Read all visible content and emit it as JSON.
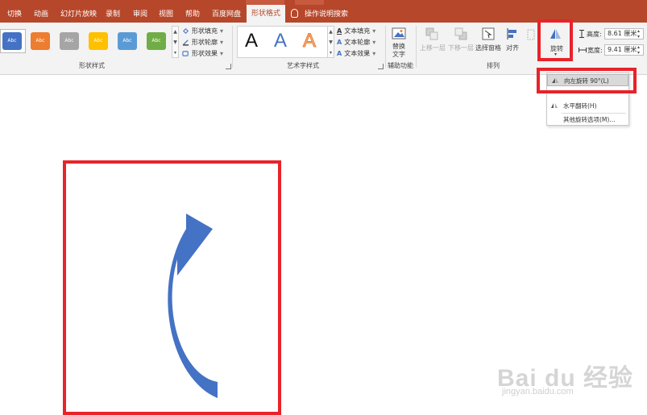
{
  "tabs": [
    {
      "label": "切换"
    },
    {
      "label": "动画"
    },
    {
      "label": "幻灯片放映"
    },
    {
      "label": "录制"
    },
    {
      "label": "审阅"
    },
    {
      "label": "视图"
    },
    {
      "label": "帮助"
    },
    {
      "label": "百度网盘"
    },
    {
      "label": "形状格式"
    }
  ],
  "search": {
    "label": "操作说明搜索"
  },
  "shape_styles": {
    "swatch_label": "Abc",
    "swatch_colors": [
      "#4472c4",
      "#ed7d31",
      "#a5a5a5",
      "#ffc000",
      "#5b9bd5",
      "#70ad47"
    ],
    "fill": "形状填充",
    "outline": "形状轮廓",
    "effects": "形状效果",
    "group_label": "形状样式"
  },
  "wordart": {
    "letters": [
      "A",
      "A",
      "A"
    ],
    "text_fill": "文本填充",
    "text_outline": "文本轮廓",
    "text_effects": "文本效果",
    "group_label": "艺术字样式"
  },
  "accessibility": {
    "alt_text_line1": "替换",
    "alt_text_line2": "文字",
    "group_label": "辅助功能"
  },
  "arrange": {
    "bring_forward": "上移一层",
    "send_backward": "下移一层",
    "selection_pane": "选择窗格",
    "align": "对齐",
    "rotate": "旋转",
    "group_label": "排列"
  },
  "size": {
    "height_label": "高度:",
    "height_value": "8.61 厘米",
    "width_label": "宽度:",
    "width_value": "9.41 厘米"
  },
  "rotate_menu": {
    "rotate_left": "向左旋转 90°(L)",
    "flip_horizontal": "水平翻转(H)",
    "more_options": "其他旋转选项(M)..."
  },
  "colors": {
    "tab_bar": "#b7472a",
    "arrow": "#4472c4",
    "highlight": "#e8232a"
  },
  "watermark": {
    "brand": "Bai du 经验",
    "url": "jingyan.baidu.com"
  }
}
